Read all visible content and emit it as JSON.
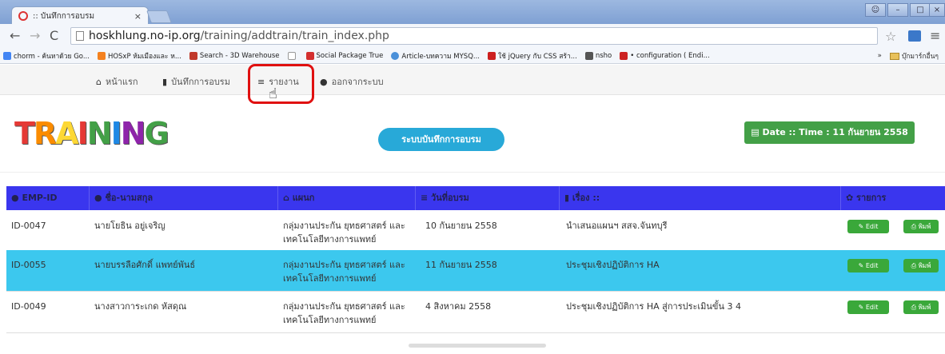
{
  "browser": {
    "tab_title": ":: บันทึกการอบรม",
    "tab_close": "×",
    "url_host": "hoskhlung.no-ip.org",
    "url_path": "/training/addtrain/train_index.php",
    "bookmarks": [
      {
        "label": "chorm - ค้นหาด้วย Go...",
        "color": "#4285f4"
      },
      {
        "label": "HOSxP ห้มเมืองและ ห...",
        "color": "#f4811f"
      },
      {
        "label": "Search - 3D Warehouse",
        "color": "#c0392b"
      },
      {
        "label": "",
        "color": "#bbbbbb"
      },
      {
        "label": "Social Package True",
        "color": "#d32f2f"
      },
      {
        "label": "Article-บทความ MYSQ...",
        "color": "#4a90d9"
      },
      {
        "label": "ใช้ jQuery กับ CSS สร้า...",
        "color": "#cc1f1f"
      },
      {
        "label": "nsho",
        "color": "#555555"
      },
      {
        "label": "• configuration ( Endi...",
        "color": "#cc2222"
      }
    ],
    "bookmarks_more": "»",
    "other_bookmarks": "บุ๊กมาร์กอื่นๆ"
  },
  "nav": {
    "home": "หน้าแรก",
    "record": "บันทึกการอบรม",
    "report": "รายงาน",
    "logout": "ออกจากระบบ"
  },
  "header": {
    "logo_text": "TRAINING",
    "system_button": "ระบบบันทึกการอบรม",
    "date_label": "Date :: Time : 11 กันยายน 2558"
  },
  "table": {
    "columns": [
      "EMP-ID",
      "ชื่อ-นามสกุล",
      "แผนก",
      "วันที่อบรม",
      "เรื่อง ::",
      "รายการ"
    ],
    "rows": [
      {
        "id": "ID-0047",
        "name": "นายโยธิน อยู่เจริญ",
        "dept": "กลุ่มงานประกัน ยุทธศาสตร์ และ เทคโนโลยีทางการแพทย์",
        "date": "10 กันยายน 2558",
        "topic": "นำเสนอแผนฯ สสจ.จันทบุรี",
        "edit": "Edit",
        "print": "พิมพ์"
      },
      {
        "id": "ID-0055",
        "name": "นายบรรลือศักดิ์ แพทย์พันธ์",
        "dept": "กลุ่มงานประกัน ยุทธศาสตร์ และ เทคโนโลยีทางการแพทย์",
        "date": "11 กันยายน 2558",
        "topic": "ประชุมเชิงปฏิบัติการ HA",
        "edit": "Edit",
        "print": "พิมพ์"
      },
      {
        "id": "ID-0049",
        "name": "นางสาวการะเกด หัสดุณ",
        "dept": "กลุ่มงานประกัน ยุทธศาสตร์ และ เทคโนโลยีทางการแพทย์",
        "date": "4 สิงหาคม 2558",
        "topic": "ประชุมเชิงปฏิบัติการ HA สู่การประเมินขั้น 3 4",
        "edit": "Edit",
        "print": "พิมพ์"
      }
    ]
  },
  "colors": {
    "table_header": "#3a36ee",
    "row_highlight": "#3cc8ee",
    "green": "#43a047",
    "pill": "#28a9d8",
    "callout": "#e01010"
  }
}
